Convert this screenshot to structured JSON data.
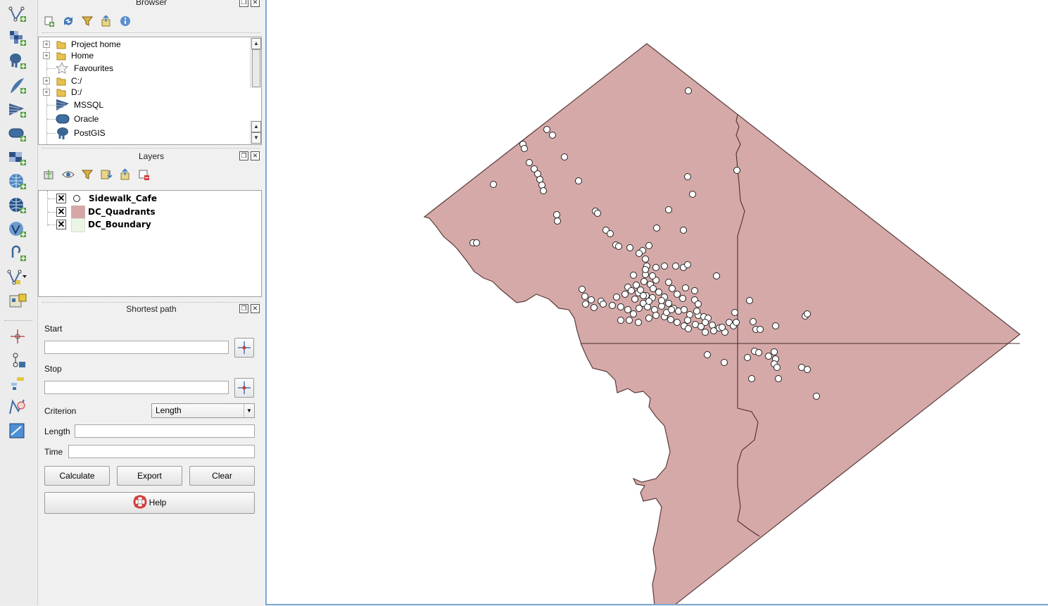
{
  "browser": {
    "title": "Browser",
    "items": [
      {
        "label": "Project home",
        "icon": "folder-icon"
      },
      {
        "label": "Home",
        "icon": "folder-icon"
      },
      {
        "label": "Favourites",
        "icon": "star-icon"
      },
      {
        "label": "C:/",
        "icon": "folder-icon"
      },
      {
        "label": "D:/",
        "icon": "folder-icon"
      },
      {
        "label": "MSSQL",
        "icon": "mssql-icon"
      },
      {
        "label": "Oracle",
        "icon": "oracle-icon"
      },
      {
        "label": "PostGIS",
        "icon": "postgis-icon"
      }
    ]
  },
  "layers": {
    "title": "Layers",
    "items": [
      {
        "label": "Sidewalk_Cafe",
        "checked": true,
        "symbol": "white-circle"
      },
      {
        "label": "DC_Quadrants",
        "checked": true,
        "symbol": "#d6a6a6"
      },
      {
        "label": "DC_Boundary",
        "checked": true,
        "symbol": "#ebf5e6"
      }
    ]
  },
  "shortest_path": {
    "title": "Shortest path",
    "start_label": "Start",
    "start_value": "",
    "stop_label": "Stop",
    "stop_value": "",
    "criterion_label": "Criterion",
    "criterion_value": "Length",
    "length_label": "Length",
    "length_value": "",
    "time_label": "Time",
    "time_value": "",
    "calculate": "Calculate",
    "export": "Export",
    "clear": "Clear",
    "help": "Help"
  },
  "toolbar": {
    "icons": [
      "add-vector-layer-icon",
      "add-raster-layer-icon",
      "add-postgis-layer-icon",
      "add-spatialite-layer-icon",
      "add-mssql-layer-icon",
      "add-oracle-layer-icon",
      "add-wms-layer-icon",
      "add-wcs-layer-icon",
      "add-wfs-layer-icon",
      "add-delimited-text-icon",
      "new-shapefile-icon",
      "add-virtual-layer-icon",
      "digitize-point-icon",
      "node-tool-icon",
      "move-feature-icon",
      "georeferencer-icon",
      "map-frame-icon"
    ]
  },
  "map": {
    "polygon_fill": "#d6a9a9",
    "polygon_stroke": "#5a3b3b",
    "point_fill": "#ffffff",
    "point_stroke": "#222222"
  }
}
